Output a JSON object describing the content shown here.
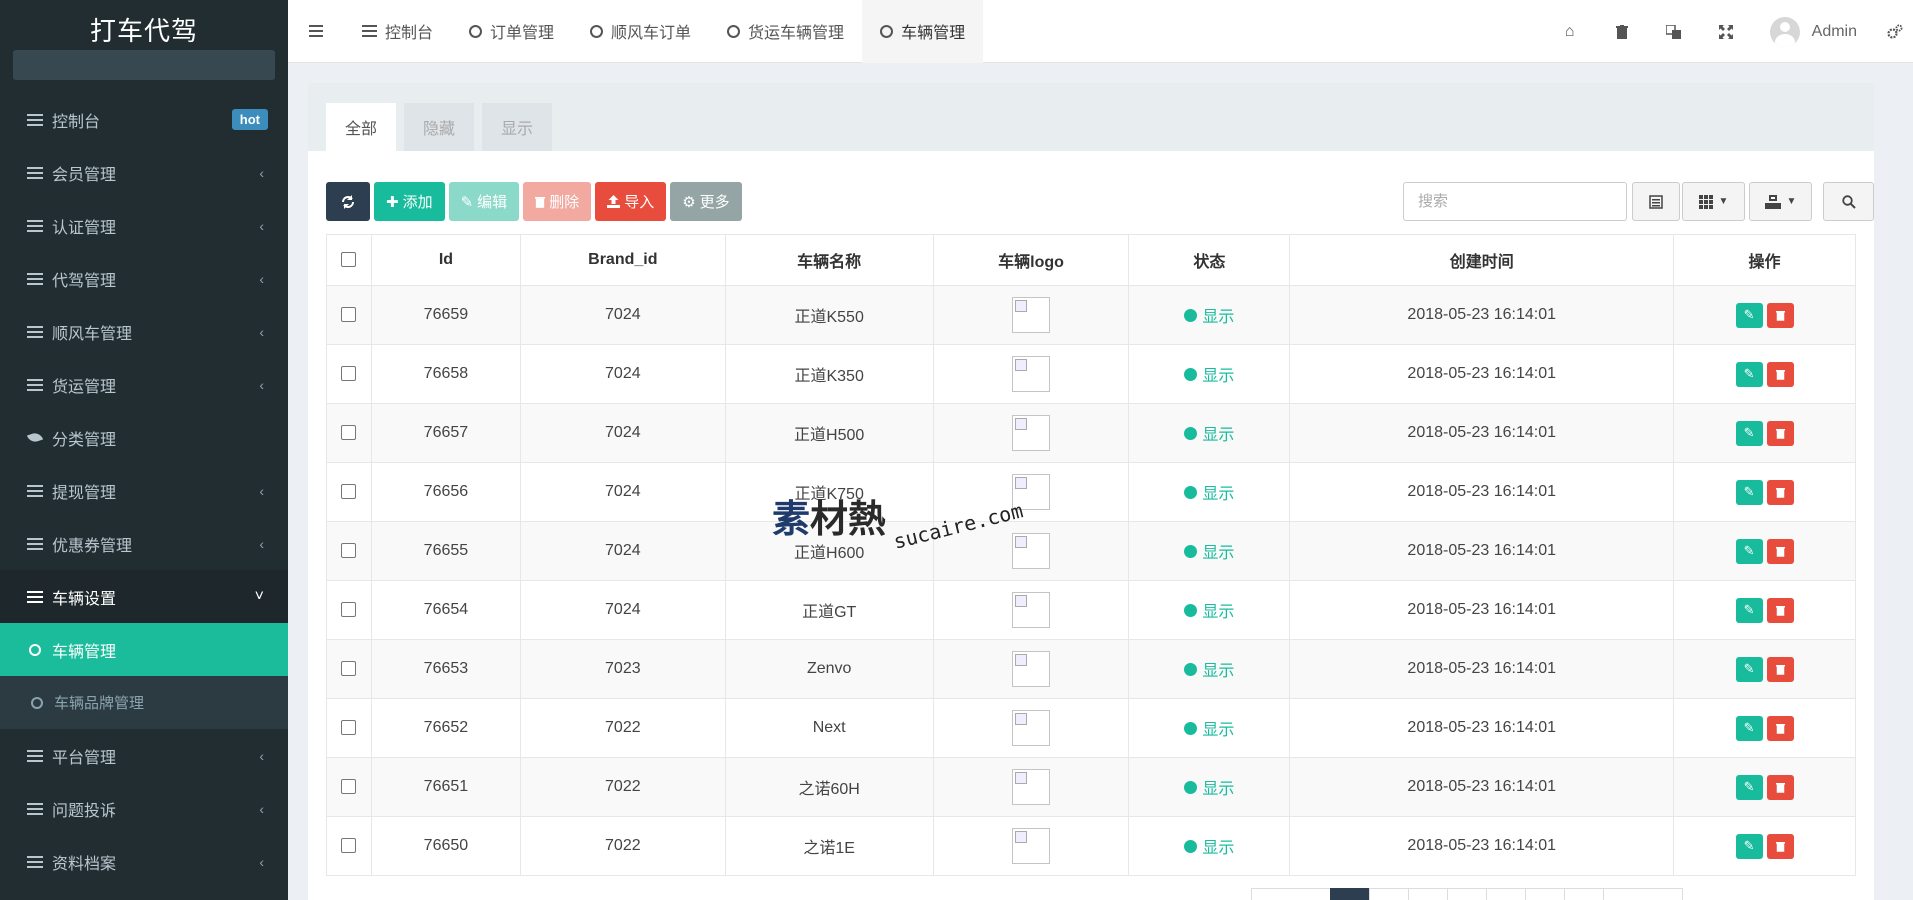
{
  "app": {
    "title": "打车代驾"
  },
  "sidebar": {
    "items": [
      {
        "label": "控制台",
        "badge": "hot",
        "icon": "list-icon"
      },
      {
        "label": "会员管理",
        "icon": "list-icon"
      },
      {
        "label": "认证管理",
        "icon": "list-icon"
      },
      {
        "label": "代驾管理",
        "icon": "list-icon"
      },
      {
        "label": "顺风车管理",
        "icon": "list-icon"
      },
      {
        "label": "货运管理",
        "icon": "list-icon"
      },
      {
        "label": "分类管理",
        "icon": "leaf-icon"
      },
      {
        "label": "提现管理",
        "icon": "list-icon"
      },
      {
        "label": "优惠券管理",
        "icon": "list-icon"
      },
      {
        "label": "车辆设置",
        "icon": "list-icon",
        "expanded": true
      },
      {
        "label": "车辆管理",
        "icon": "circle-icon",
        "active": true
      },
      {
        "label": "车辆品牌管理",
        "icon": "circle-icon"
      },
      {
        "label": "平台管理",
        "icon": "list-icon"
      },
      {
        "label": "问题投诉",
        "icon": "list-icon"
      },
      {
        "label": "资料档案",
        "icon": "list-icon"
      }
    ]
  },
  "topbar": {
    "tabs": [
      {
        "label": "控制台"
      },
      {
        "label": "订单管理"
      },
      {
        "label": "顺风车订单"
      },
      {
        "label": "货运车辆管理"
      },
      {
        "label": "车辆管理",
        "active": true
      }
    ],
    "user": "Admin"
  },
  "panel": {
    "tabs": [
      "全部",
      "隐藏",
      "显示"
    ],
    "toolbar": {
      "add": "添加",
      "edit": "编辑",
      "delete": "删除",
      "import": "导入",
      "more": "更多"
    },
    "search_placeholder": "搜索"
  },
  "table": {
    "columns": [
      "Id",
      "Brand_id",
      "车辆名称",
      "车辆logo",
      "状态",
      "创建时间",
      "操作"
    ],
    "rows": [
      {
        "id": "76659",
        "brand_id": "7024",
        "name": "正道K550",
        "status": "显示",
        "created": "2018-05-23 16:14:01"
      },
      {
        "id": "76658",
        "brand_id": "7024",
        "name": "正道K350",
        "status": "显示",
        "created": "2018-05-23 16:14:01"
      },
      {
        "id": "76657",
        "brand_id": "7024",
        "name": "正道H500",
        "status": "显示",
        "created": "2018-05-23 16:14:01"
      },
      {
        "id": "76656",
        "brand_id": "7024",
        "name": "正道K750",
        "status": "显示",
        "created": "2018-05-23 16:14:01"
      },
      {
        "id": "76655",
        "brand_id": "7024",
        "name": "正道H600",
        "status": "显示",
        "created": "2018-05-23 16:14:01"
      },
      {
        "id": "76654",
        "brand_id": "7024",
        "name": "正道GT",
        "status": "显示",
        "created": "2018-05-23 16:14:01"
      },
      {
        "id": "76653",
        "brand_id": "7023",
        "name": "Zenvo",
        "status": "显示",
        "created": "2018-05-23 16:14:01"
      },
      {
        "id": "76652",
        "brand_id": "7022",
        "name": "Next",
        "status": "显示",
        "created": "2018-05-23 16:14:01"
      },
      {
        "id": "76651",
        "brand_id": "7022",
        "name": "之诺60H",
        "status": "显示",
        "created": "2018-05-23 16:14:01"
      },
      {
        "id": "76650",
        "brand_id": "7022",
        "name": "之诺1E",
        "status": "显示",
        "created": "2018-05-23 16:14:01"
      }
    ]
  },
  "watermark": {
    "cn_first": "素",
    "cn_rest": "材熱",
    "en": "sucaire.com"
  },
  "colors": {
    "accent": "#18bc9c",
    "sidebar": "#222d32",
    "danger": "#e74c3c",
    "dark": "#2c3e50"
  }
}
